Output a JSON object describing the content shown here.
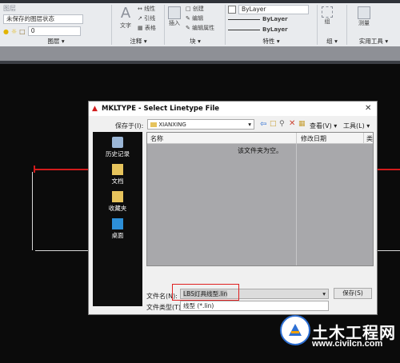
{
  "ribbon": {
    "top_partial": "图层",
    "layer_state": "未保存的图层状态",
    "layer_current": "0",
    "text_label": "文字",
    "annotation_items": [
      "线性",
      "引线",
      "表格"
    ],
    "insert_label": "插入",
    "block_items": [
      "创建",
      "编辑",
      "编辑属性"
    ],
    "layer_color": "ByLayer",
    "layer_linetype": "ByLayer",
    "layer_lineweight": "ByLayer",
    "group_label": "组",
    "utilities": [
      "测量"
    ],
    "group_labels": {
      "layer": "图层",
      "annotation": "注释",
      "block": "块",
      "properties": "特性",
      "groups": "组",
      "utilities": "实用工具"
    }
  },
  "dialog": {
    "title": "MKLTYPE - Select Linetype File",
    "save_in_label": "保存于(I):",
    "save_in_value": "XIANXING",
    "view_label": "查看(V)",
    "tools_label": "工具(L)",
    "columns": [
      "名称",
      "修改日期",
      "类"
    ],
    "empty_message": "该文件夹为空。",
    "sidebar": [
      "历史记录",
      "文档",
      "收藏夹",
      "桌面"
    ],
    "filename_label": "文件名(N):",
    "filename_value": "LBS灯具线型.lin",
    "filetype_label": "文件类型(T):",
    "filetype_value": "线型 (*.lin)",
    "save_button": "保存(S)"
  },
  "watermark": {
    "text": "土木工程网",
    "url": "www.civilcn.com"
  },
  "colors": {
    "accent_red": "#d21b1b",
    "watermark_blue": "#2d6fd3",
    "file_list_bg": "#a8a8ab"
  }
}
